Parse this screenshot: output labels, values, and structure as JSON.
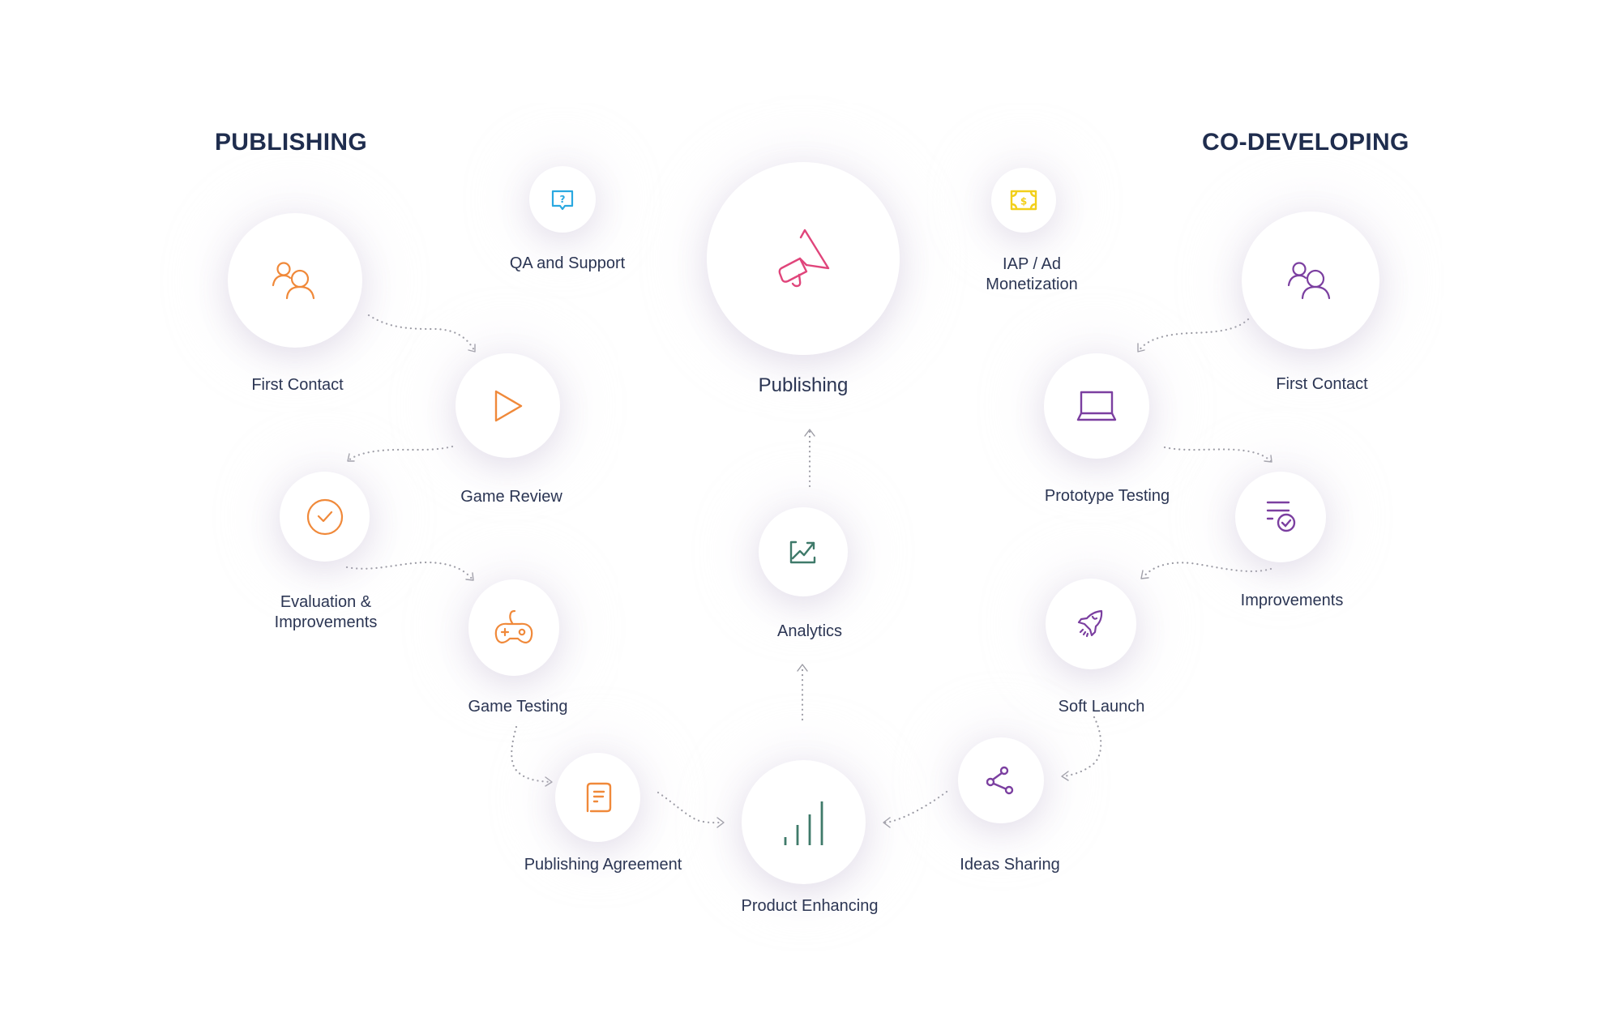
{
  "headings": {
    "publishing": "PUBLISHING",
    "co_developing": "CO-DEVELOPING"
  },
  "colors": {
    "heading": "#1f2d4e",
    "label": "#2b3553",
    "publishing_accent": "#f0893a",
    "co_developing_accent": "#7b3fa0",
    "center_accent": "#e0457b",
    "analytics_accent": "#3f7a6a",
    "qa_accent": "#2aa8e0",
    "monetization_accent": "#f2cf1a",
    "arrow": "#9a9aa3"
  },
  "center": {
    "publishing": {
      "label": "Publishing",
      "icon": "megaphone-icon"
    },
    "qa_support": {
      "label": "QA and Support",
      "icon": "question-chat-icon"
    },
    "iap_monetization": {
      "label_line1": "IAP / Ad",
      "label_line2": "Monetization",
      "icon": "money-bill-icon"
    },
    "analytics": {
      "label": "Analytics",
      "icon": "trend-chart-icon"
    },
    "product_enhancing": {
      "label": "Product Enhancing",
      "icon": "signal-bars-icon"
    }
  },
  "publishing_flow": [
    {
      "label": "First Contact",
      "icon": "users-icon"
    },
    {
      "label": "Game Review",
      "icon": "play-icon"
    },
    {
      "label_line1": "Evaluation &",
      "label_line2": "Improvements",
      "icon": "check-circle-icon"
    },
    {
      "label": "Game Testing",
      "icon": "gamepad-icon"
    },
    {
      "label": "Publishing Agreement",
      "icon": "document-icon"
    }
  ],
  "co_developing_flow": [
    {
      "label": "First Contact",
      "icon": "users-icon"
    },
    {
      "label": "Prototype Testing",
      "icon": "laptop-icon"
    },
    {
      "label": "Improvements",
      "icon": "list-check-icon"
    },
    {
      "label": "Soft Launch",
      "icon": "rocket-icon"
    },
    {
      "label": "Ideas Sharing",
      "icon": "share-icon"
    }
  ]
}
